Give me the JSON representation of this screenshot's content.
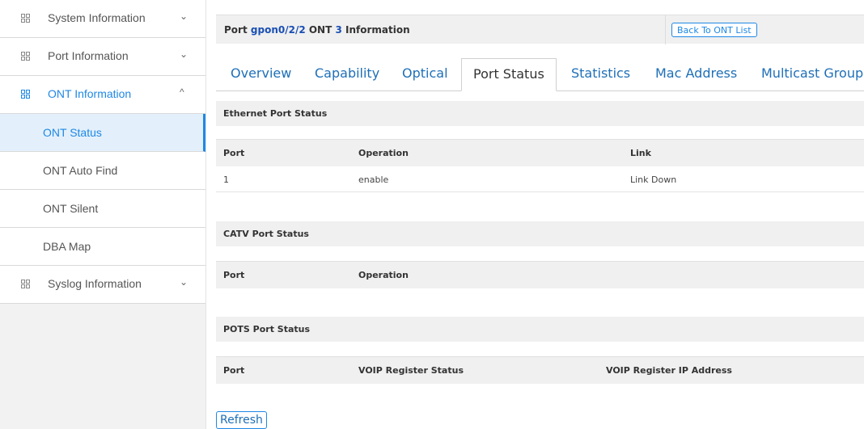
{
  "sidebar": {
    "items": [
      {
        "label": "System Information",
        "chevron": "⌄"
      },
      {
        "label": "Port Information",
        "chevron": "⌄"
      },
      {
        "label": "ONT Information",
        "chevron": "^"
      },
      {
        "label": "Syslog Information",
        "chevron": "⌄"
      }
    ],
    "sub_items": [
      {
        "label": "ONT Status"
      },
      {
        "label": "ONT Auto Find"
      },
      {
        "label": "ONT Silent"
      },
      {
        "label": "DBA Map"
      }
    ]
  },
  "header": {
    "port_prefix": "Port",
    "port_value": "gpon0/2/2",
    "ont_prefix": "ONT",
    "ont_value": "3",
    "suffix": "Information",
    "back_button": "Back To ONT List"
  },
  "tabs": [
    {
      "label": "Overview"
    },
    {
      "label": "Capability"
    },
    {
      "label": "Optical"
    },
    {
      "label": "Port Status"
    },
    {
      "label": "Statistics"
    },
    {
      "label": "Mac Address"
    },
    {
      "label": "Multicast Group"
    }
  ],
  "ethernet": {
    "title": "Ethernet Port Status",
    "columns": [
      "Port",
      "Operation",
      "Link"
    ],
    "rows": [
      [
        "1",
        "enable",
        "Link Down"
      ]
    ]
  },
  "catv": {
    "title": "CATV Port Status",
    "columns": [
      "Port",
      "Operation"
    ]
  },
  "pots": {
    "title": "POTS Port Status",
    "columns": [
      "Port",
      "VOIP Register Status",
      "VOIP Register IP Address"
    ]
  },
  "refresh_button": "Refresh",
  "colors": {
    "accent": "#1e88e5",
    "link": "#1e6fb8",
    "header_bg": "#f0f0f0"
  }
}
